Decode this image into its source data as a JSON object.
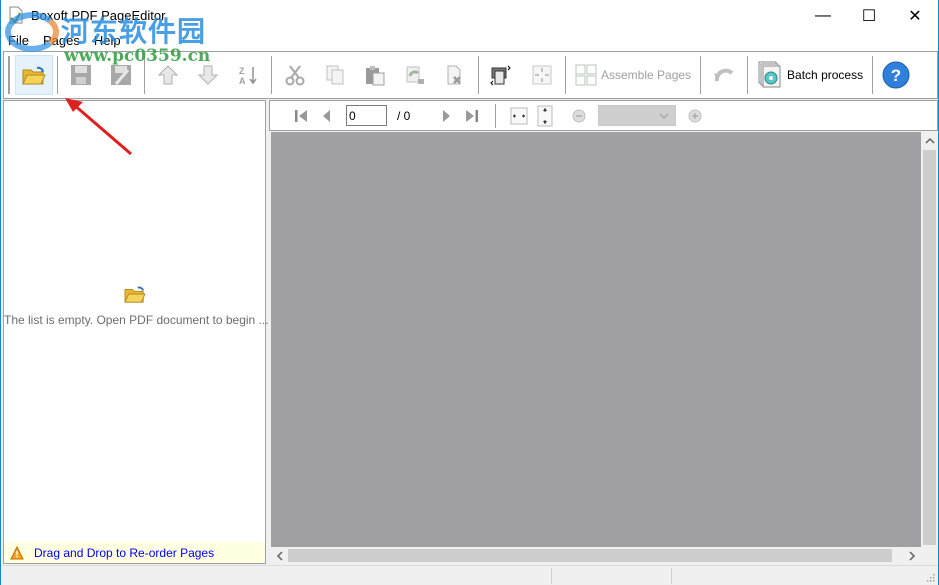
{
  "window": {
    "title": "Boxoft PDF PageEditor",
    "controls": {
      "minimize": "—",
      "maximize": "☐",
      "close": "✕"
    }
  },
  "menu": [
    "File",
    "Pages",
    "Help"
  ],
  "toolbar": {
    "buttons": [
      {
        "name": "open-pdf",
        "icon": "folder-open-icon",
        "enabled": true
      },
      {
        "name": "save",
        "icon": "floppy-icon",
        "enabled": false
      },
      {
        "name": "save-as",
        "icon": "floppy-edit-icon",
        "enabled": false
      },
      {
        "name": "move-up",
        "icon": "arrow-up-icon",
        "enabled": false
      },
      {
        "name": "move-down",
        "icon": "arrow-down-icon",
        "enabled": false
      },
      {
        "name": "sort",
        "icon": "sort-za-icon",
        "enabled": false
      },
      {
        "name": "cut",
        "icon": "scissors-icon",
        "enabled": false
      },
      {
        "name": "copy",
        "icon": "copy-icon",
        "enabled": false
      },
      {
        "name": "paste",
        "icon": "paste-icon",
        "enabled": false
      },
      {
        "name": "rotate-page",
        "icon": "rotate-icon",
        "enabled": false
      },
      {
        "name": "delete-page",
        "icon": "delete-page-icon",
        "enabled": false
      },
      {
        "name": "page-layout",
        "icon": "page-layout-icon",
        "enabled": true
      },
      {
        "name": "fit",
        "icon": "fit-icon",
        "enabled": false
      }
    ],
    "assemble_label": "Assemble Pages",
    "batch_label": "Batch process",
    "help_symbol": "?"
  },
  "left_pane": {
    "empty_text": "The list is empty. Open  PDF document to begin ...",
    "hint": "Drag and Drop to Re-order Pages"
  },
  "viewer_toolbar": {
    "page_value": "0",
    "page_total": "/ 0",
    "zoom_value": ""
  },
  "watermark": {
    "text": "河东软件园",
    "url": "www.pc0359.cn"
  }
}
